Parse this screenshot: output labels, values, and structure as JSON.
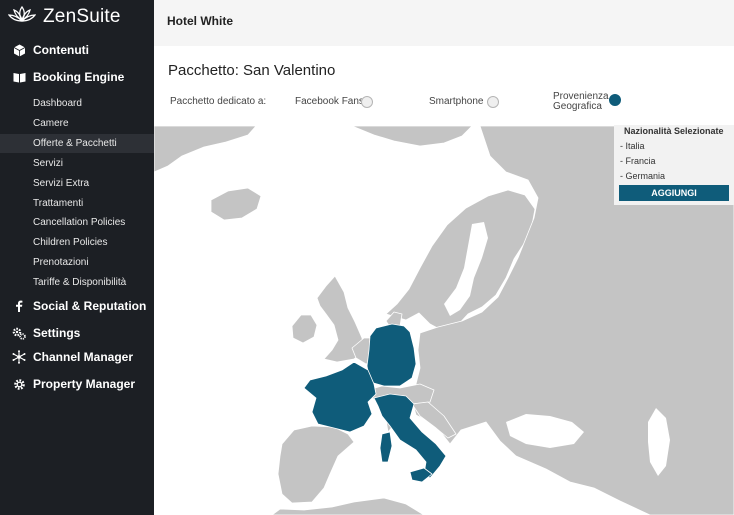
{
  "app": {
    "name": "ZenSuite"
  },
  "colors": {
    "accent": "#0f5c7a",
    "sidebar_bg": "#1c1f24",
    "map_land": "#c4c4c4"
  },
  "sidebar": {
    "main_items": [
      {
        "label": "Contenuti",
        "icon": "cube-icon"
      },
      {
        "label": "Booking Engine",
        "icon": "book-icon"
      },
      {
        "label": "Social & Reputation",
        "icon": "facebook-icon"
      },
      {
        "label": "Settings",
        "icon": "gears-icon"
      },
      {
        "label": "Channel Manager",
        "icon": "network-icon"
      },
      {
        "label": "Property Manager",
        "icon": "gear-icon"
      }
    ],
    "sub_items": [
      {
        "label": "Dashboard"
      },
      {
        "label": "Camere"
      },
      {
        "label": "Offerte & Pacchetti",
        "active": true
      },
      {
        "label": "Servizi"
      },
      {
        "label": "Servizi Extra"
      },
      {
        "label": "Trattamenti"
      },
      {
        "label": "Cancellation Policies"
      },
      {
        "label": "Children Policies"
      },
      {
        "label": "Prenotazioni"
      },
      {
        "label": "Tariffe & Disponibilità"
      }
    ]
  },
  "header": {
    "hotel_name": "Hotel White"
  },
  "package": {
    "title": "Pacchetto: San Valentino",
    "dedicated_label": "Pacchetto dedicato a:",
    "options": [
      {
        "label": "Facebook Fans",
        "selected": false
      },
      {
        "label": "Smartphone",
        "selected": false
      },
      {
        "label_line1": "Provenienza",
        "label_line2": "Geografica",
        "selected": true
      }
    ]
  },
  "nationalities": {
    "title": "Nazionalità Selezionate",
    "items": [
      "- Italia",
      "- Francia",
      "- Germania"
    ],
    "add_button": "AGGIUNGI"
  },
  "map": {
    "selected_countries": [
      "Italia",
      "Francia",
      "Germania"
    ]
  }
}
